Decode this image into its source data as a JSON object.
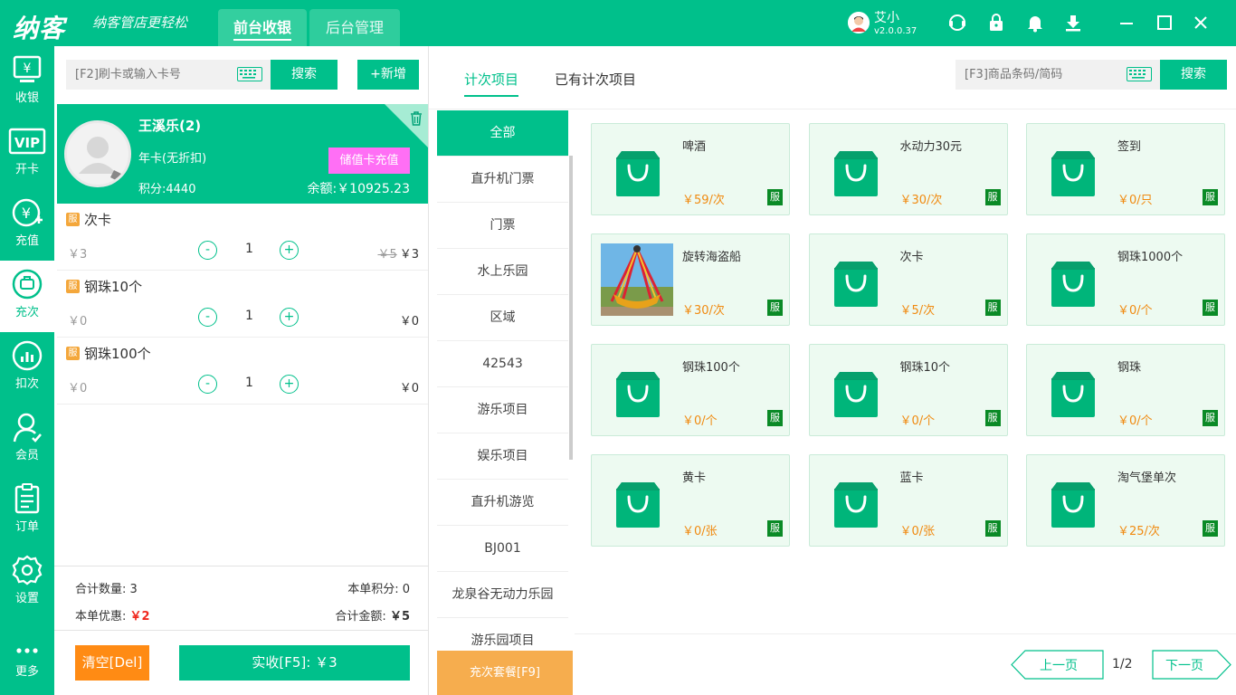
{
  "topbar": {
    "logo": "纳客",
    "slogan": "纳客管店更轻松",
    "tabs": [
      "前台收银",
      "后台管理"
    ],
    "user_name": "艾小",
    "version": "v2.0.0.37",
    "icons": [
      "headset-icon",
      "lock-icon",
      "bell-icon",
      "download-icon",
      "minimize-icon",
      "maximize-icon",
      "close-icon"
    ]
  },
  "sidebar": {
    "items": [
      {
        "label": "收银",
        "icon": "cashier-icon"
      },
      {
        "label": "开卡",
        "icon": "vip-icon"
      },
      {
        "label": "充值",
        "icon": "recharge-icon"
      },
      {
        "label": "充次",
        "icon": "recharge-times-icon"
      },
      {
        "label": "扣次",
        "icon": "deduct-times-icon"
      },
      {
        "label": "会员",
        "icon": "member-icon"
      },
      {
        "label": "订单",
        "icon": "order-icon"
      },
      {
        "label": "设置",
        "icon": "settings-icon"
      },
      {
        "label": "更多",
        "icon": "more-icon"
      }
    ]
  },
  "search": {
    "card_placeholder": "[F2]刷卡或输入卡号",
    "search_label": "搜索",
    "add_label": "+新增"
  },
  "member": {
    "name": "王溪乐(2)",
    "card_type": "年卡(无折扣)",
    "recharge_label": "储值卡充值",
    "points": "积分:4440",
    "balance": "余额:￥10925.23"
  },
  "cart": {
    "badge": "服",
    "items": [
      {
        "name": "次卡",
        "price": "￥3",
        "qty": "1",
        "original": "￥5",
        "total": "￥3"
      },
      {
        "name": "钢珠10个",
        "price": "￥0",
        "qty": "1",
        "original": "",
        "total": "￥0"
      },
      {
        "name": "钢珠100个",
        "price": "￥0",
        "qty": "1",
        "original": "",
        "total": "￥0"
      }
    ]
  },
  "summary": {
    "qty_label": "合计数量:",
    "qty": "3",
    "points_label": "本单积分:",
    "points": "0",
    "discount_label": "本单优惠:",
    "discount": "￥2",
    "amount_label": "合计金额:",
    "amount": "￥5"
  },
  "actions": {
    "clear": "清空[Del]",
    "pay": "实收[F5]:  ￥3"
  },
  "right": {
    "tabs": [
      "计次项目",
      "已有计次项目"
    ],
    "barcode_placeholder": "[F3]商品条码/简码",
    "search_label": "搜索"
  },
  "categories": [
    "全部",
    "直升机门票",
    "门票",
    "水上乐园",
    "区域",
    "42543",
    "游乐项目",
    "娱乐项目",
    "直升机游览",
    "BJ001",
    "龙泉谷无动力乐园",
    "游乐园项目"
  ],
  "package_label": "充次套餐[F9]",
  "products": [
    {
      "name": "啤酒",
      "price": "￥59/次",
      "image": "bag"
    },
    {
      "name": "水动力30元",
      "price": "￥30/次",
      "image": "bag"
    },
    {
      "name": "签到",
      "price": "￥0/只",
      "image": "bag"
    },
    {
      "name": "旋转海盗船",
      "price": "￥30/次",
      "image": "photo"
    },
    {
      "name": "次卡",
      "price": "￥5/次",
      "image": "bag"
    },
    {
      "name": "钢珠1000个",
      "price": "￥0/个",
      "image": "bag"
    },
    {
      "name": "钢珠100个",
      "price": "￥0/个",
      "image": "bag"
    },
    {
      "name": "钢珠10个",
      "price": "￥0/个",
      "image": "bag"
    },
    {
      "name": "钢珠",
      "price": "￥0/个",
      "image": "bag"
    },
    {
      "name": "黄卡",
      "price": "￥0/张",
      "image": "bag"
    },
    {
      "name": "蓝卡",
      "price": "￥0/张",
      "image": "bag"
    },
    {
      "name": "淘气堡单次",
      "price": "￥25/次",
      "image": "bag"
    }
  ],
  "service_badge": "服",
  "pager": {
    "prev": "上一页",
    "page": "1/2",
    "next": "下一页"
  },
  "colors": {
    "primary": "#00c08b",
    "recharge": "#ff6ff5",
    "clear": "#ff8b14",
    "package": "#f6ad4e",
    "price": "#f08a10",
    "service": "#0a8a26"
  }
}
